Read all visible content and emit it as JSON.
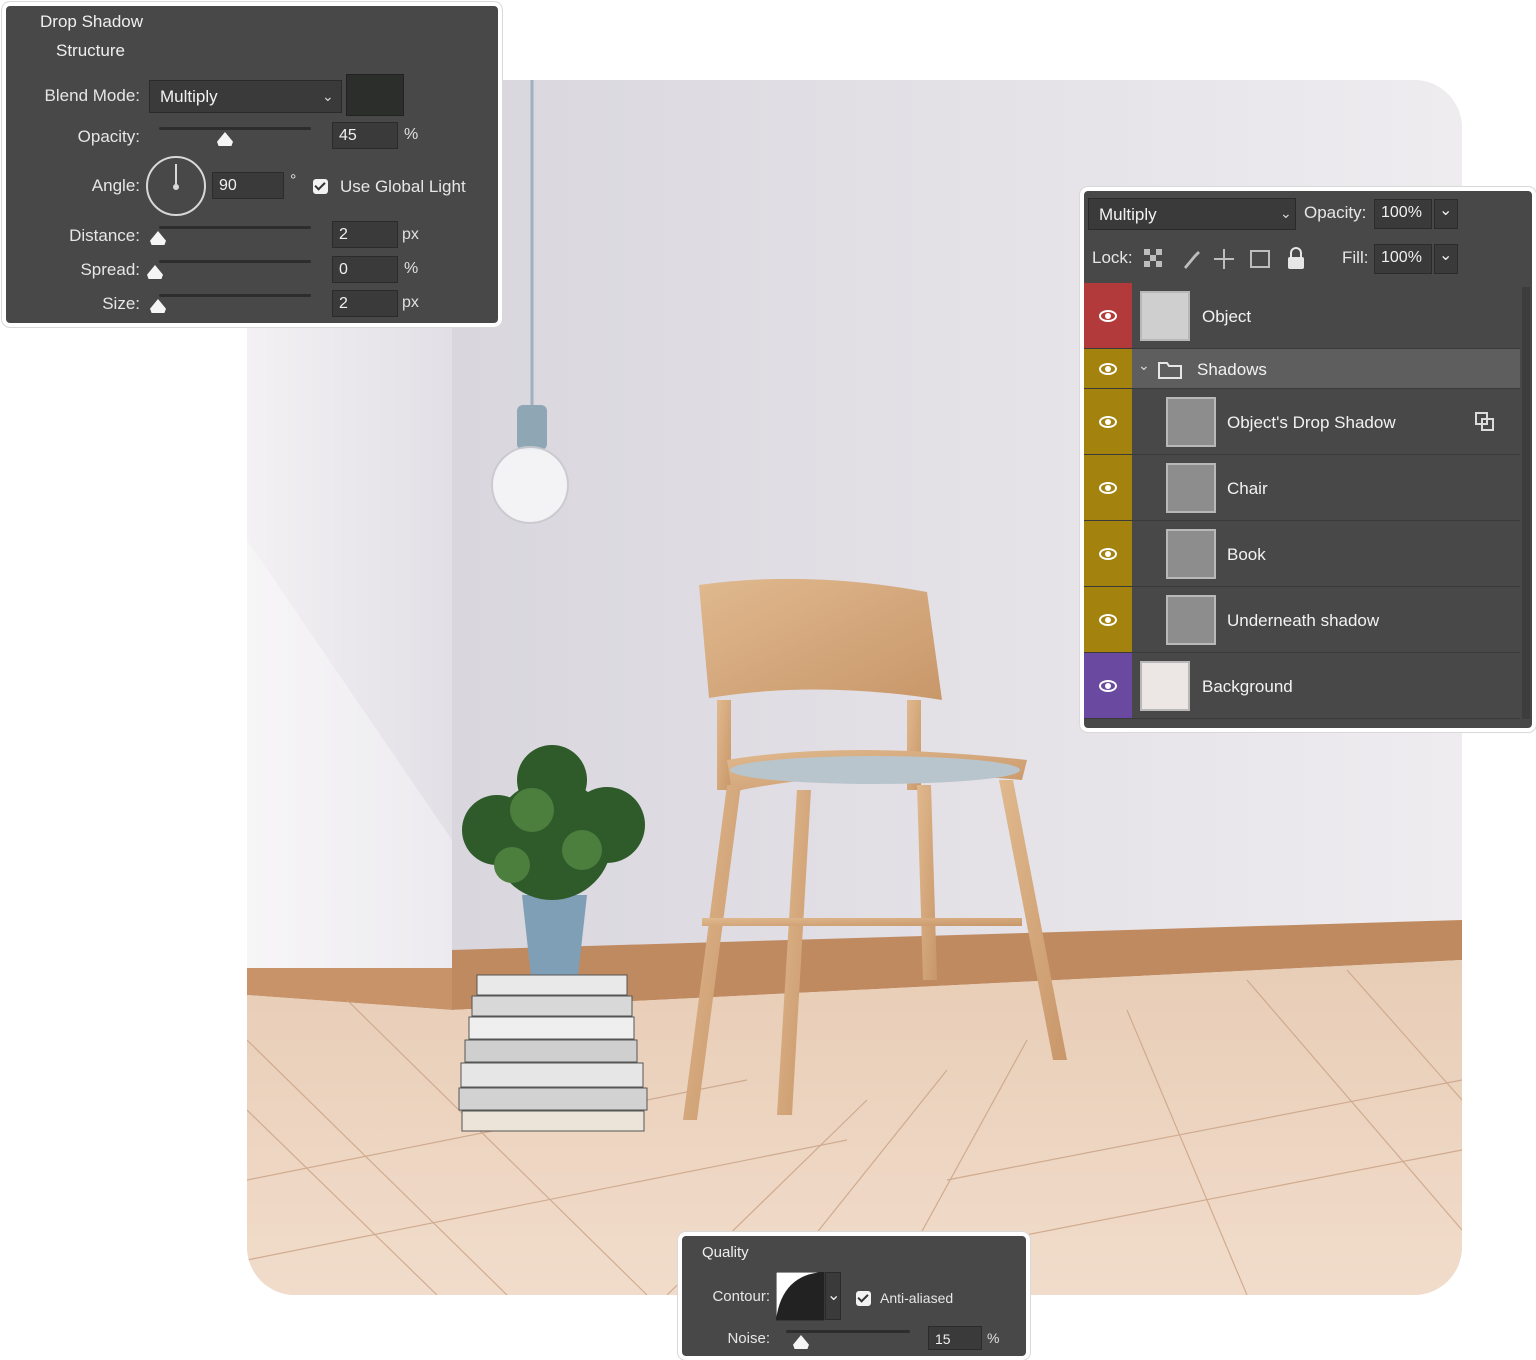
{
  "drop_shadow": {
    "title": "Drop Shadow",
    "section": "Structure",
    "blend_mode_label": "Blend Mode:",
    "blend_mode_value": "Multiply",
    "shadow_color": "#2b2e2a",
    "opacity_label": "Opacity:",
    "opacity_value": "45",
    "opacity_unit": "%",
    "angle_label": "Angle:",
    "angle_value": "90",
    "angle_unit": "°",
    "global_light_label": "Use Global Light",
    "distance_label": "Distance:",
    "distance_value": "2",
    "distance_unit": "px",
    "spread_label": "Spread:",
    "spread_value": "0",
    "spread_unit": "%",
    "size_label": "Size:",
    "size_value": "2",
    "size_unit": "px"
  },
  "layers_panel": {
    "blend_mode": "Multiply",
    "opacity_label": "Opacity:",
    "opacity_value": "100%",
    "lock_label": "Lock:",
    "fill_label": "Fill:",
    "fill_value": "100%",
    "layers": [
      {
        "name": "Object",
        "color": "#b33a3a"
      },
      {
        "name": "Shadows",
        "color": "#a4820e"
      },
      {
        "name": "Object's Drop Shadow",
        "color": "#a4820e"
      },
      {
        "name": "Chair",
        "color": "#a4820e"
      },
      {
        "name": "Book",
        "color": "#a4820e"
      },
      {
        "name": "Underneath shadow",
        "color": "#a4820e"
      },
      {
        "name": "Background",
        "color": "#6a4aa0"
      }
    ]
  },
  "quality": {
    "title": "Quality",
    "contour_label": "Contour:",
    "anti_aliased_label": "Anti-aliased",
    "noise_label": "Noise:",
    "noise_value": "15",
    "noise_unit": "%"
  }
}
